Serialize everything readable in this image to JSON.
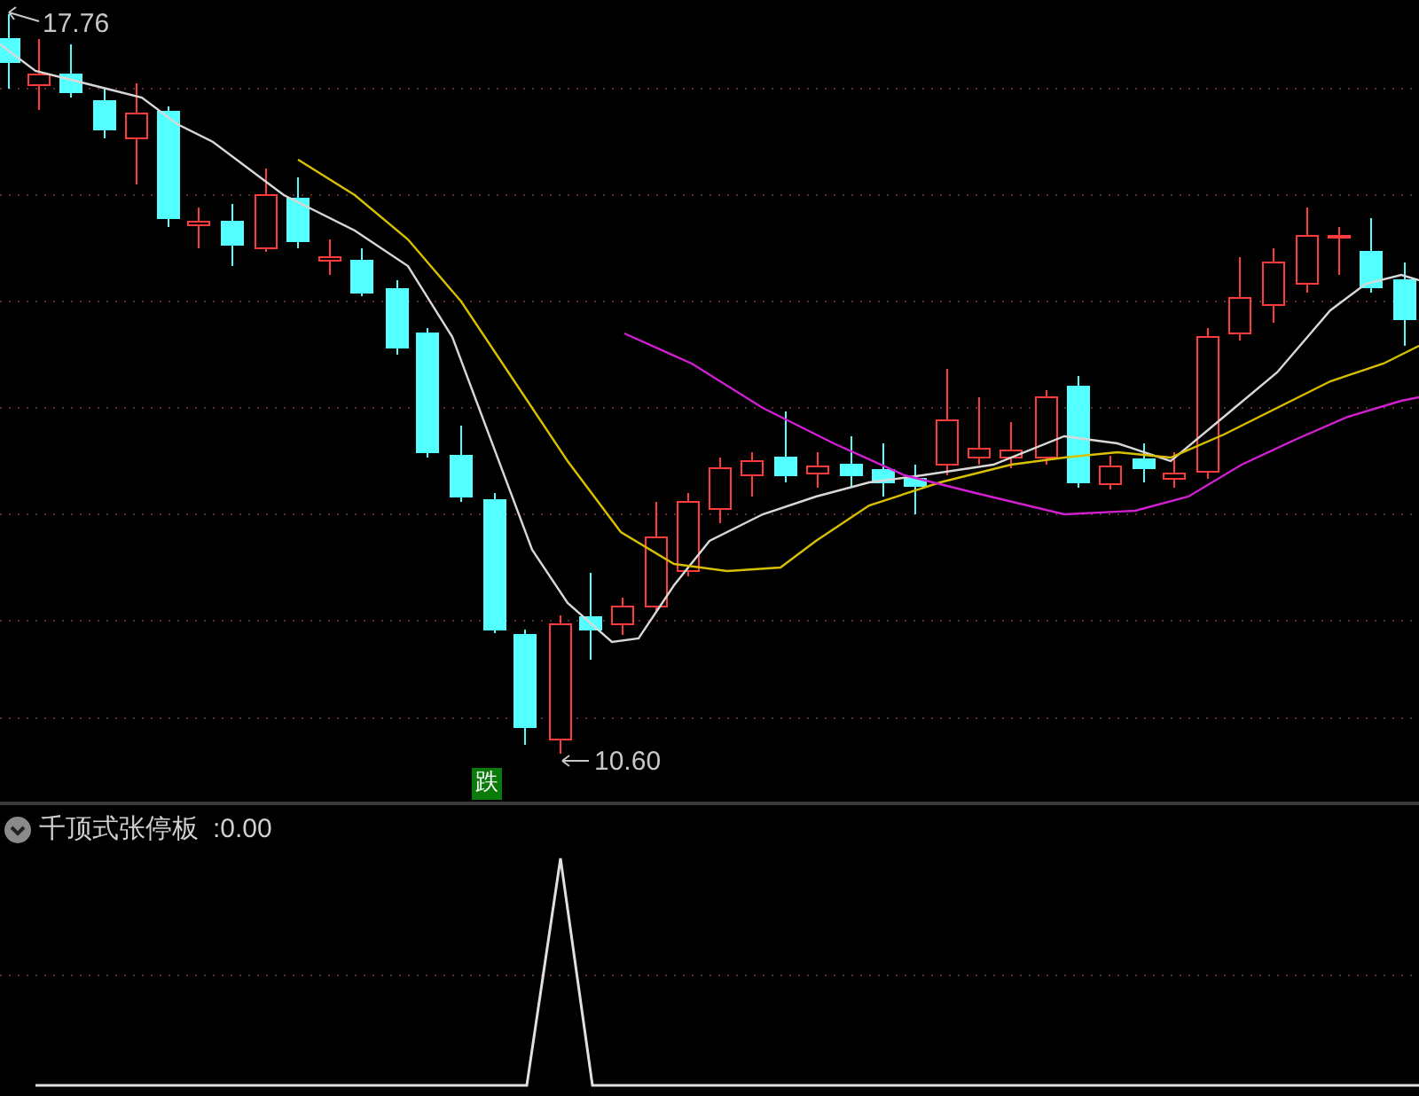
{
  "main_chart": {
    "high_label": "17.76",
    "low_label": "10.60",
    "signal_badge": "跌"
  },
  "indicator_pane": {
    "title": "千顶式张停板",
    "value": ":0.00"
  }
}
